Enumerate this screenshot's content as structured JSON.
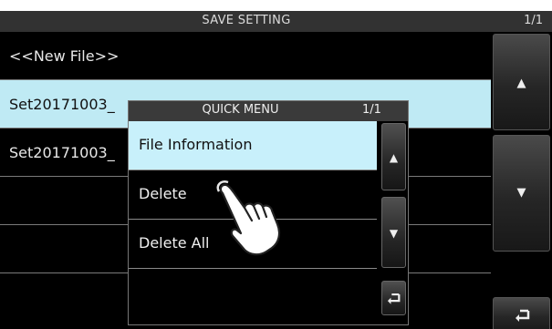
{
  "header": {
    "title": "SAVE SETTING",
    "page": "1/1"
  },
  "list": {
    "items": [
      {
        "label": "<<New File>>",
        "selected": false
      },
      {
        "label": "Set20171003_",
        "selected": true
      },
      {
        "label": "Set20171003_",
        "selected": false
      },
      {
        "label": "",
        "selected": false
      },
      {
        "label": "",
        "selected": false
      },
      {
        "label": "",
        "selected": false
      }
    ]
  },
  "side_buttons": {
    "up": "▲",
    "down": "▼",
    "back": "⮌"
  },
  "quick_menu": {
    "title": "QUICK MENU",
    "page": "1/1",
    "items": [
      {
        "label": "File Information",
        "selected": true
      },
      {
        "label": "Delete",
        "selected": false
      },
      {
        "label": "Delete All",
        "selected": false
      },
      {
        "label": "",
        "selected": false
      }
    ],
    "buttons": {
      "up": "▲",
      "down": "▼",
      "back": "⮌"
    }
  },
  "colors": {
    "selected_row": "#bfeaf4",
    "background": "#000000",
    "title_bar": "#323232"
  },
  "icons": [
    "up-arrow-icon",
    "down-arrow-icon",
    "return-icon",
    "pointing-hand-icon"
  ]
}
